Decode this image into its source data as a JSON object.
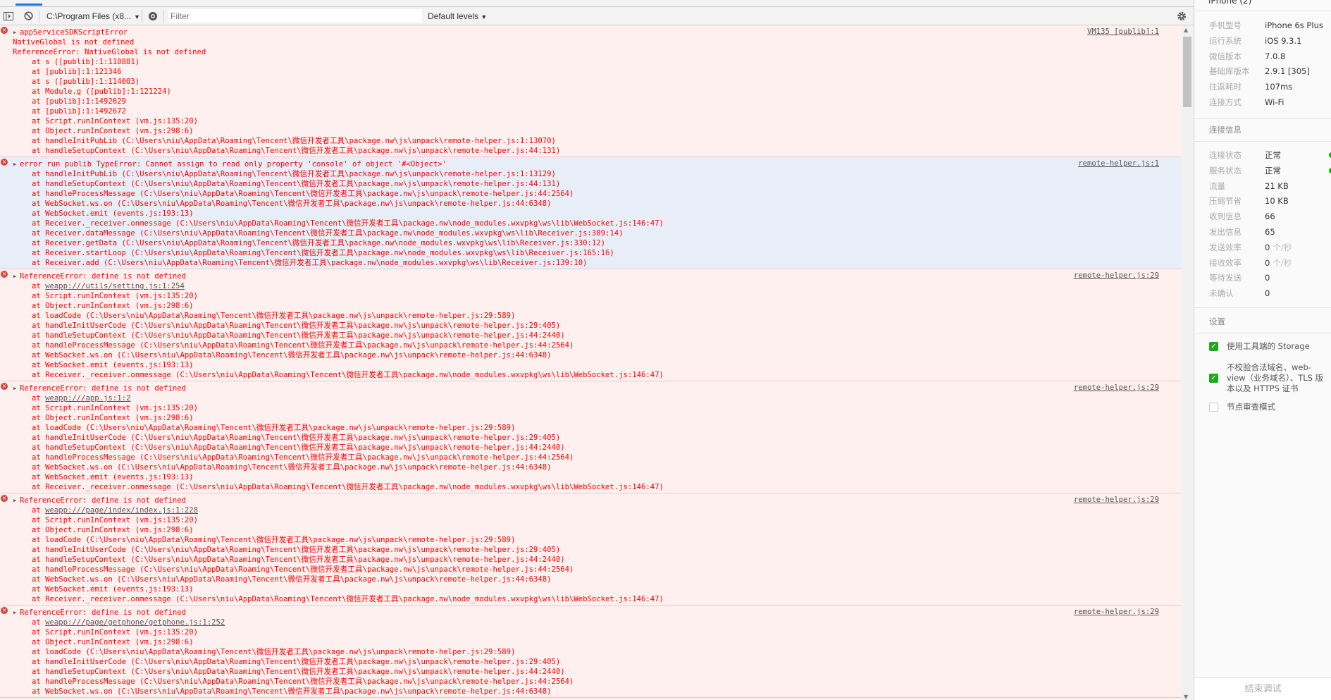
{
  "toolbar": {
    "context": "C:\\Program Files (x8...",
    "filter_placeholder": "Filter",
    "levels": "Default levels"
  },
  "console": {
    "groups": [
      {
        "type": "error",
        "bg": "error",
        "source": "VM135 [publib]:1",
        "header": "appServiceSDKScriptError",
        "messages": [
          "NativeGlobal is not defined",
          "ReferenceError: NativeGlobal is not defined"
        ],
        "stack": [
          {
            "text": "at s ([publib]:1:118881)"
          },
          {
            "text": "at [publib]:1:121346"
          },
          {
            "text": "at s ([publib]:1:114003)"
          },
          {
            "text": "at Module.g ([publib]:1:121224)"
          },
          {
            "text": "at [publib]:1:1492629"
          },
          {
            "text": "at [publib]:1:1492672"
          },
          {
            "text": "at Script.runInContext (vm.js:135:20)"
          },
          {
            "text": "at Object.runInContext (vm.js:298:6)"
          },
          {
            "text": "at handleInitPubLib (C:\\Users\\niu\\AppData\\Roaming\\Tencent\\微信开发者工具\\package.nw\\js\\unpack\\remote-helper.js:1:13070)"
          },
          {
            "text": "at handleSetupContext (C:\\Users\\niu\\AppData\\Roaming\\Tencent\\微信开发者工具\\package.nw\\js\\unpack\\remote-helper.js:44:131)"
          }
        ]
      },
      {
        "type": "error",
        "bg": "info",
        "source": "remote-helper.js:1",
        "header": "error run publib TypeError: Cannot assign to read only property 'console' of object '#<Object>'",
        "messages": [],
        "stack": [
          {
            "text": "at handleInitPubLib (C:\\Users\\niu\\AppData\\Roaming\\Tencent\\微信开发者工具\\package.nw\\js\\unpack\\remote-helper.js:1:13129)"
          },
          {
            "text": "at handleSetupContext (C:\\Users\\niu\\AppData\\Roaming\\Tencent\\微信开发者工具\\package.nw\\js\\unpack\\remote-helper.js:44:131)"
          },
          {
            "text": "at handleProcessMessage (C:\\Users\\niu\\AppData\\Roaming\\Tencent\\微信开发者工具\\package.nw\\js\\unpack\\remote-helper.js:44:2564)"
          },
          {
            "text": "at WebSocket.ws.on (C:\\Users\\niu\\AppData\\Roaming\\Tencent\\微信开发者工具\\package.nw\\js\\unpack\\remote-helper.js:44:6348)"
          },
          {
            "text": "at WebSocket.emit (events.js:193:13)"
          },
          {
            "text": "at Receiver._receiver.onmessage (C:\\Users\\niu\\AppData\\Roaming\\Tencent\\微信开发者工具\\package.nw\\node_modules.wxvpkg\\ws\\lib\\WebSocket.js:146:47)"
          },
          {
            "text": "at Receiver.dataMessage (C:\\Users\\niu\\AppData\\Roaming\\Tencent\\微信开发者工具\\package.nw\\node_modules.wxvpkg\\ws\\lib\\Receiver.js:389:14)"
          },
          {
            "text": "at Receiver.getData (C:\\Users\\niu\\AppData\\Roaming\\Tencent\\微信开发者工具\\package.nw\\node_modules.wxvpkg\\ws\\lib\\Receiver.js:330:12)"
          },
          {
            "text": "at Receiver.startLoop (C:\\Users\\niu\\AppData\\Roaming\\Tencent\\微信开发者工具\\package.nw\\node_modules.wxvpkg\\ws\\lib\\Receiver.js:165:16)"
          },
          {
            "text": "at Receiver.add (C:\\Users\\niu\\AppData\\Roaming\\Tencent\\微信开发者工具\\package.nw\\node_modules.wxvpkg\\ws\\lib\\Receiver.js:139:10)"
          }
        ]
      },
      {
        "type": "error",
        "bg": "error",
        "source": "remote-helper.js:29",
        "header": "ReferenceError: define is not defined",
        "messages": [],
        "stack": [
          {
            "text": "at ",
            "link": "weapp:///utils/setting.js:1:254"
          },
          {
            "text": "at Script.runInContext (vm.js:135:20)"
          },
          {
            "text": "at Object.runInContext (vm.js:298:6)"
          },
          {
            "text": "at loadCode (C:\\Users\\niu\\AppData\\Roaming\\Tencent\\微信开发者工具\\package.nw\\js\\unpack\\remote-helper.js:29:589)"
          },
          {
            "text": "at handleInitUserCode (C:\\Users\\niu\\AppData\\Roaming\\Tencent\\微信开发者工具\\package.nw\\js\\unpack\\remote-helper.js:29:405)"
          },
          {
            "text": "at handleSetupContext (C:\\Users\\niu\\AppData\\Roaming\\Tencent\\微信开发者工具\\package.nw\\js\\unpack\\remote-helper.js:44:2440)"
          },
          {
            "text": "at handleProcessMessage (C:\\Users\\niu\\AppData\\Roaming\\Tencent\\微信开发者工具\\package.nw\\js\\unpack\\remote-helper.js:44:2564)"
          },
          {
            "text": "at WebSocket.ws.on (C:\\Users\\niu\\AppData\\Roaming\\Tencent\\微信开发者工具\\package.nw\\js\\unpack\\remote-helper.js:44:6348)"
          },
          {
            "text": "at WebSocket.emit (events.js:193:13)"
          },
          {
            "text": "at Receiver._receiver.onmessage (C:\\Users\\niu\\AppData\\Roaming\\Tencent\\微信开发者工具\\package.nw\\node_modules.wxvpkg\\ws\\lib\\WebSocket.js:146:47)"
          }
        ]
      },
      {
        "type": "error",
        "bg": "error",
        "source": "remote-helper.js:29",
        "header": "ReferenceError: define is not defined",
        "messages": [],
        "stack": [
          {
            "text": "at ",
            "link": "weapp:///app.js:1:2"
          },
          {
            "text": "at Script.runInContext (vm.js:135:20)"
          },
          {
            "text": "at Object.runInContext (vm.js:298:6)"
          },
          {
            "text": "at loadCode (C:\\Users\\niu\\AppData\\Roaming\\Tencent\\微信开发者工具\\package.nw\\js\\unpack\\remote-helper.js:29:589)"
          },
          {
            "text": "at handleInitUserCode (C:\\Users\\niu\\AppData\\Roaming\\Tencent\\微信开发者工具\\package.nw\\js\\unpack\\remote-helper.js:29:405)"
          },
          {
            "text": "at handleSetupContext (C:\\Users\\niu\\AppData\\Roaming\\Tencent\\微信开发者工具\\package.nw\\js\\unpack\\remote-helper.js:44:2440)"
          },
          {
            "text": "at handleProcessMessage (C:\\Users\\niu\\AppData\\Roaming\\Tencent\\微信开发者工具\\package.nw\\js\\unpack\\remote-helper.js:44:2564)"
          },
          {
            "text": "at WebSocket.ws.on (C:\\Users\\niu\\AppData\\Roaming\\Tencent\\微信开发者工具\\package.nw\\js\\unpack\\remote-helper.js:44:6348)"
          },
          {
            "text": "at WebSocket.emit (events.js:193:13)"
          },
          {
            "text": "at Receiver._receiver.onmessage (C:\\Users\\niu\\AppData\\Roaming\\Tencent\\微信开发者工具\\package.nw\\node_modules.wxvpkg\\ws\\lib\\WebSocket.js:146:47)"
          }
        ]
      },
      {
        "type": "error",
        "bg": "error",
        "source": "remote-helper.js:29",
        "header": "ReferenceError: define is not defined",
        "messages": [],
        "stack": [
          {
            "text": "at ",
            "link": "weapp:///page/index/index.js:1:228"
          },
          {
            "text": "at Script.runInContext (vm.js:135:20)"
          },
          {
            "text": "at Object.runInContext (vm.js:298:6)"
          },
          {
            "text": "at loadCode (C:\\Users\\niu\\AppData\\Roaming\\Tencent\\微信开发者工具\\package.nw\\js\\unpack\\remote-helper.js:29:589)"
          },
          {
            "text": "at handleInitUserCode (C:\\Users\\niu\\AppData\\Roaming\\Tencent\\微信开发者工具\\package.nw\\js\\unpack\\remote-helper.js:29:405)"
          },
          {
            "text": "at handleSetupContext (C:\\Users\\niu\\AppData\\Roaming\\Tencent\\微信开发者工具\\package.nw\\js\\unpack\\remote-helper.js:44:2440)"
          },
          {
            "text": "at handleProcessMessage (C:\\Users\\niu\\AppData\\Roaming\\Tencent\\微信开发者工具\\package.nw\\js\\unpack\\remote-helper.js:44:2564)"
          },
          {
            "text": "at WebSocket.ws.on (C:\\Users\\niu\\AppData\\Roaming\\Tencent\\微信开发者工具\\package.nw\\js\\unpack\\remote-helper.js:44:6348)"
          },
          {
            "text": "at WebSocket.emit (events.js:193:13)"
          },
          {
            "text": "at Receiver._receiver.onmessage (C:\\Users\\niu\\AppData\\Roaming\\Tencent\\微信开发者工具\\package.nw\\node_modules.wxvpkg\\ws\\lib\\WebSocket.js:146:47)"
          }
        ]
      },
      {
        "type": "error",
        "bg": "error",
        "source": "remote-helper.js:29",
        "header": "ReferenceError: define is not defined",
        "messages": [],
        "stack": [
          {
            "text": "at ",
            "link": "weapp:///page/getphone/getphone.js:1:252"
          },
          {
            "text": "at Script.runInContext (vm.js:135:20)"
          },
          {
            "text": "at Object.runInContext (vm.js:298:6)"
          },
          {
            "text": "at loadCode (C:\\Users\\niu\\AppData\\Roaming\\Tencent\\微信开发者工具\\package.nw\\js\\unpack\\remote-helper.js:29:589)"
          },
          {
            "text": "at handleInitUserCode (C:\\Users\\niu\\AppData\\Roaming\\Tencent\\微信开发者工具\\package.nw\\js\\unpack\\remote-helper.js:29:405)"
          },
          {
            "text": "at handleSetupContext (C:\\Users\\niu\\AppData\\Roaming\\Tencent\\微信开发者工具\\package.nw\\js\\unpack\\remote-helper.js:44:2440)"
          },
          {
            "text": "at handleProcessMessage (C:\\Users\\niu\\AppData\\Roaming\\Tencent\\微信开发者工具\\package.nw\\js\\unpack\\remote-helper.js:44:2564)"
          },
          {
            "text": "at WebSocket.ws.on (C:\\Users\\niu\\AppData\\Roaming\\Tencent\\微信开发者工具\\package.nw\\js\\unpack\\remote-helper.js:44:6348)"
          }
        ]
      }
    ]
  },
  "panel": {
    "title": "iPhone (2)",
    "device": [
      {
        "label": "手机型号",
        "value": "iPhone 6s Plus"
      },
      {
        "label": "运行系统",
        "value": "iOS 9.3.1"
      },
      {
        "label": "微信版本",
        "value": "7.0.8"
      },
      {
        "label": "基础库版本",
        "value": "2.9.1 [305]"
      },
      {
        "label": "往返耗时",
        "value": "107ms"
      },
      {
        "label": "连接方式",
        "value": "Wi-Fi"
      }
    ],
    "connection_title": "连接信息",
    "connection": [
      {
        "label": "连接状态",
        "value": "正常",
        "status": "ok"
      },
      {
        "label": "服务状态",
        "value": "正常",
        "status": "ok"
      },
      {
        "label": "流量",
        "value": "21 KB"
      },
      {
        "label": "压缩节省",
        "value": "10 KB"
      },
      {
        "label": "收到信息",
        "value": "66"
      },
      {
        "label": "发出信息",
        "value": "65"
      },
      {
        "label": "发送效率",
        "value": "0",
        "unit": "个/秒"
      },
      {
        "label": "接收效率",
        "value": "0",
        "unit": "个/秒"
      },
      {
        "label": "等待发送",
        "value": "0"
      },
      {
        "label": "未确认",
        "value": "0"
      }
    ],
    "settings_title": "设置",
    "settings": [
      {
        "label": "使用工具端的 Storage",
        "checked": true
      },
      {
        "label": "不校验合法域名、web-view（业务域名）、TLS 版本以及 HTTPS 证书",
        "checked": true
      },
      {
        "label": "节点审查模式",
        "checked": false
      }
    ],
    "end_button": "结束调试",
    "status_color": "#1aad19"
  }
}
